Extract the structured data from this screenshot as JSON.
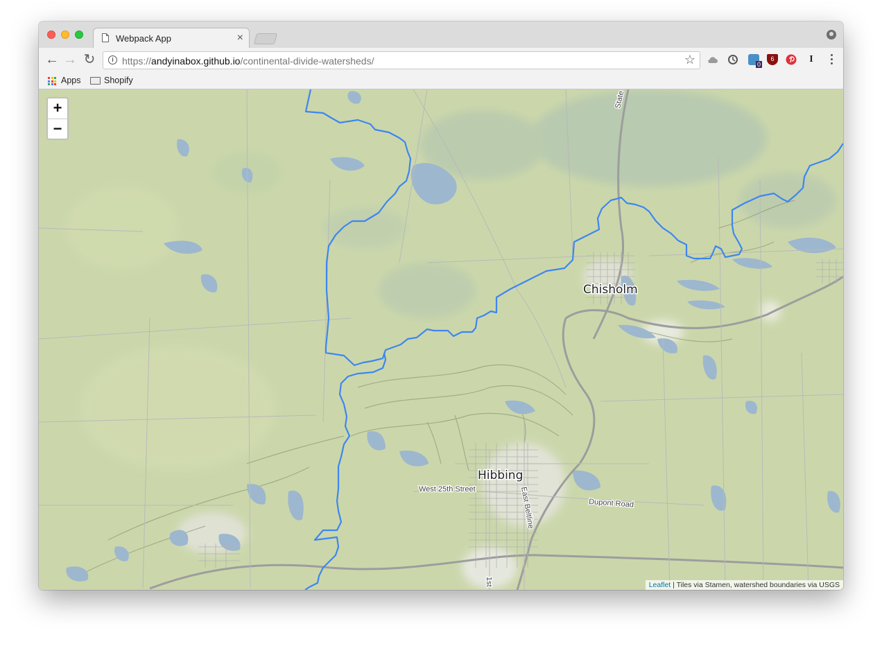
{
  "browser": {
    "tab_title": "Webpack App",
    "tab_close": "×",
    "url_prefix": "https://",
    "url_host": "andyinabox.github.io",
    "url_path": "/continental-divide-watersheds/",
    "bookmarks": [
      {
        "label": "Apps",
        "icon": "apps-grid-icon"
      },
      {
        "label": "Shopify",
        "icon": "folder-icon"
      }
    ],
    "nav": {
      "back": "←",
      "forward": "→",
      "reload": "↻"
    },
    "star": "☆",
    "extensions": [
      "cloud-icon",
      "sync-icon",
      "ext-badge-icon",
      "ublock-icon",
      "pinterest-icon",
      "instapaper-icon"
    ],
    "ext_badge_count": "0",
    "ublock_count": "6",
    "instapaper_letter": "I"
  },
  "map": {
    "zoom_in": "+",
    "zoom_out": "−",
    "labels": {
      "chisholm": "Chisholm",
      "hibbing": "Hibbing",
      "west_25th": "West 25th Street",
      "dupont": "Dupont Road",
      "east_beltline": "East Beltline",
      "state": "State",
      "first": "1st"
    },
    "attribution_link": "Leaflet",
    "attribution_text": " | Tiles via Stamen, watershed boundaries via USGS",
    "colors": {
      "land": "#cdd8ae",
      "water": "#9fb8cf",
      "watershed_line": "#3d86f0",
      "road": "#a8a8a8"
    }
  }
}
